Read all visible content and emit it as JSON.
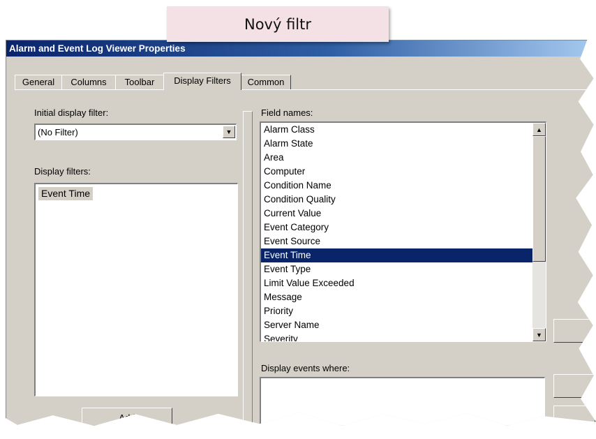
{
  "caption": "Nový filtr",
  "window": {
    "title": "Alarm and Event Log Viewer Properties"
  },
  "tabs": [
    "General",
    "Columns",
    "Toolbar",
    "Display Filters",
    "Common"
  ],
  "active_tab": "Display Filters",
  "left": {
    "initial_filter_label": "Initial display filter:",
    "initial_filter_value": "(No Filter)",
    "display_filters_label": "Display filters:",
    "display_filters": [
      "Event Time"
    ],
    "add_button": "Add"
  },
  "right": {
    "field_names_label": "Field names:",
    "field_names": [
      "Alarm Class",
      "Alarm State",
      "Area",
      "Computer",
      "Condition Name",
      "Condition Quality",
      "Current Value",
      "Event Category",
      "Event Source",
      "Event Time",
      "Event Type",
      "Limit Value Exceeded",
      "Message",
      "Priority",
      "Server Name",
      "Severity"
    ],
    "selected_field": "Event Time",
    "display_events_label": "Display events where:"
  },
  "colors": {
    "selection": "#0a246a",
    "caption_bg": "#f3e1e5",
    "dialog_bg": "#d4d0c8"
  }
}
